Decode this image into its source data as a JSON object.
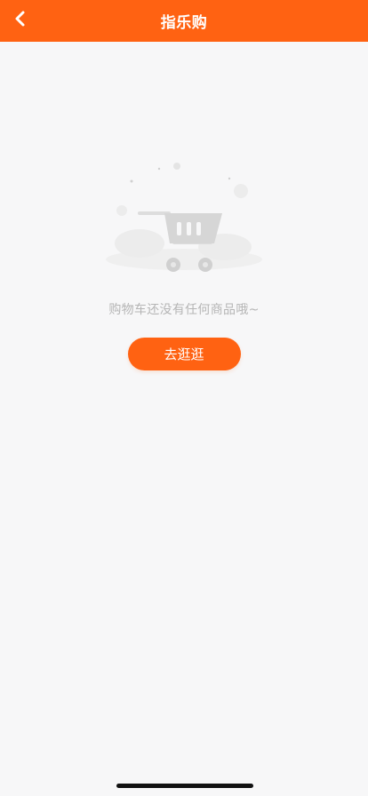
{
  "header": {
    "title": "指乐购",
    "back_icon": "chevron-left-icon"
  },
  "empty_state": {
    "illustration_icon": "shopping-cart-icon",
    "message": "购物车还没有任何商品哦~",
    "button_label": "去逛逛"
  },
  "colors": {
    "accent": "#ff6212",
    "background": "#f7f7f8",
    "muted_text": "#b5b5b5"
  }
}
